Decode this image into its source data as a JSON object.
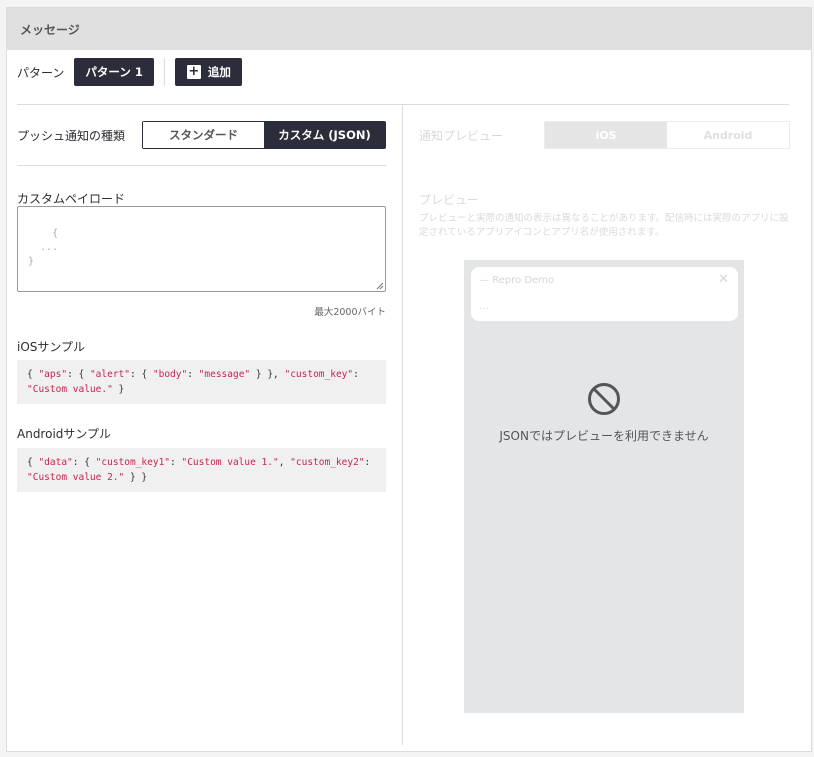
{
  "header": {
    "title": "メッセージ"
  },
  "pattern": {
    "label": "パターン",
    "active_pattern": "パターン 1",
    "add_label": "追加"
  },
  "left": {
    "push_type_label": "プッシュ通知の種類",
    "push_types": [
      "スタンダード",
      "カスタム (JSON)"
    ],
    "selected_push_type": "カスタム (JSON)",
    "payload_label": "カスタムペイロード",
    "payload_placeholder": "{\n  ...\n}",
    "payload_hint": "最大2000バイト",
    "ios_sample_label": "iOSサンプル",
    "ios_sample": {
      "p1": "{ ",
      "k1": "\"aps\"",
      "p2": ": { ",
      "k2": "\"alert\"",
      "p3": ": { ",
      "k3": "\"body\"",
      "p4": ": ",
      "k4": "\"message\"",
      "p5": " } }, ",
      "k5": "\"custom_key\"",
      "p6": ":",
      "k6": "\"Custom value.\"",
      "p7": " }"
    },
    "android_sample_label": "Androidサンプル",
    "android_sample": {
      "p1": "{ ",
      "k1": "\"data\"",
      "p2": ": { ",
      "k2": "\"custom_key1\"",
      "p3": ": ",
      "k3": "\"Custom value 1.\"",
      "p4": ", ",
      "k4": "\"custom_key2\"",
      "p5": ":",
      "k5": "\"Custom value 2.\"",
      "p6": " } }"
    }
  },
  "right": {
    "notification_preview_label": "通知プレビュー",
    "os_tabs": [
      "iOS",
      "Android"
    ],
    "selected_os": "iOS",
    "preview_title": "プレビュー",
    "preview_description": "プレビューと実際の通知の表示は異なることがあります。配信時には実際のアプリに設定されているアプリアイコンとアプリ名が使用されます。",
    "notification": {
      "app_name": "Repro Demo",
      "body": "..."
    },
    "unavailable_message": "JSONではプレビューを利用できません"
  },
  "colors": {
    "dark": "#2b2d3a",
    "code_key": "#c7254e",
    "phone_bg": "#e3e5e6"
  }
}
